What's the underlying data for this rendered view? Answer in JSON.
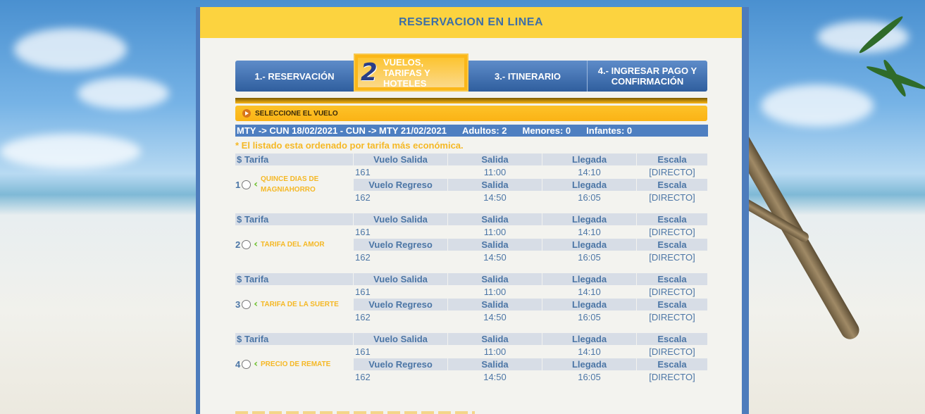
{
  "header": {
    "title": "RESERVACION EN LINEA"
  },
  "steps": {
    "step1": "1.- RESERVACIÓN",
    "step2_num": "2",
    "step2": "VUELOS, TARIFAS Y HOTELES",
    "step3": "3.- ITINERARIO",
    "step4": "4.- INGRESAR PAGO Y CONFIRMACIÓN"
  },
  "select_label": "SELECCIONE EL VUELO",
  "route": {
    "trip": "MTY -> CUN 18/02/2021 - CUN -> MTY 21/02/2021",
    "adults": "Adultos: 2",
    "minors": "Menores: 0",
    "infants": "Infantes: 0"
  },
  "note": "* El listado esta ordenado por tarifa más económica.",
  "headers": {
    "tarifa": "$ Tarifa",
    "vuelo_salida": "Vuelo Salida",
    "vuelo_regreso": "Vuelo Regreso",
    "salida": "Salida",
    "llegada": "Llegada",
    "escala": "Escala"
  },
  "fares": [
    {
      "num": "1",
      "name": "QUINCE DIAS DE MAGNIAHORRO",
      "out": {
        "flight": "161",
        "dep": "11:00",
        "arr": "14:10",
        "stop": "[DIRECTO]"
      },
      "ret": {
        "flight": "162",
        "dep": "14:50",
        "arr": "16:05",
        "stop": "[DIRECTO]"
      }
    },
    {
      "num": "2",
      "name": "TARIFA DEL AMOR",
      "out": {
        "flight": "161",
        "dep": "11:00",
        "arr": "14:10",
        "stop": "[DIRECTO]"
      },
      "ret": {
        "flight": "162",
        "dep": "14:50",
        "arr": "16:05",
        "stop": "[DIRECTO]"
      }
    },
    {
      "num": "3",
      "name": "TARIFA DE LA SUERTE",
      "out": {
        "flight": "161",
        "dep": "11:00",
        "arr": "14:10",
        "stop": "[DIRECTO]"
      },
      "ret": {
        "flight": "162",
        "dep": "14:50",
        "arr": "16:05",
        "stop": "[DIRECTO]"
      }
    },
    {
      "num": "4",
      "name": "PRECIO DE REMATE",
      "out": {
        "flight": "161",
        "dep": "11:00",
        "arr": "14:10",
        "stop": "[DIRECTO]"
      },
      "ret": {
        "flight": "162",
        "dep": "14:50",
        "arr": "16:05",
        "stop": "[DIRECTO]"
      }
    }
  ]
}
